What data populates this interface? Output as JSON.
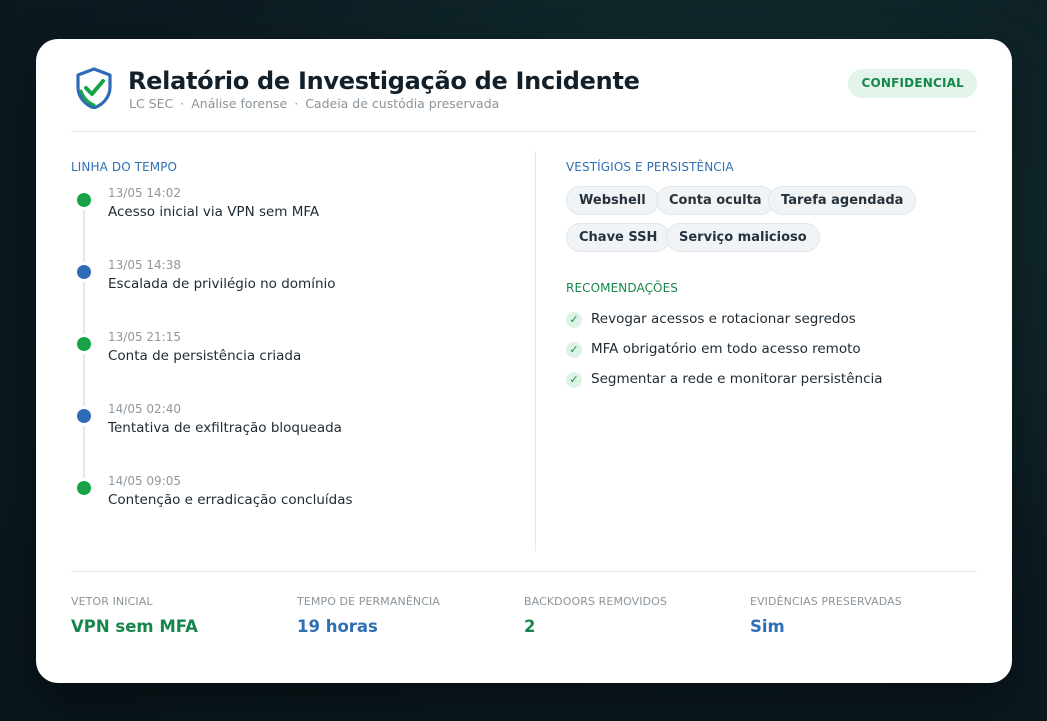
{
  "header": {
    "title": "Relatório de Investigação de Incidente",
    "subtitle": [
      "LC SEC",
      "Análise forense",
      "Cadeia de custódia preservada"
    ],
    "badge": "CONFIDENCIAL"
  },
  "colors": {
    "green": "#16a34a",
    "blue": "#2e6ab8",
    "green_text": "#16874a",
    "blue_text": "#2f6fb3"
  },
  "timeline": {
    "label": "LINHA DO TEMPO",
    "events": [
      {
        "time": "13/05  14:02",
        "text": "Acesso inicial via VPN sem MFA",
        "color": "green"
      },
      {
        "time": "13/05  14:38",
        "text": "Escalada de privilégio no domínio",
        "color": "blue"
      },
      {
        "time": "13/05  21:15",
        "text": "Conta de persistência criada",
        "color": "green"
      },
      {
        "time": "14/05  02:40",
        "text": "Tentativa de exfiltração bloqueada",
        "color": "blue"
      },
      {
        "time": "14/05  09:05",
        "text": "Contenção e erradicação concluídas",
        "color": "green"
      }
    ]
  },
  "traces": {
    "label": "VESTÍGIOS E PERSISTÊNCIA",
    "chips": [
      "Webshell",
      "Conta oculta",
      "Tarefa agendada",
      "Chave SSH",
      "Serviço malicioso"
    ]
  },
  "recommendations": {
    "label": "RECOMENDAÇÕES",
    "items": [
      "Revogar acessos e rotacionar segredos",
      "MFA obrigatório em todo acesso remoto",
      "Segmentar a rede e monitorar persistência"
    ]
  },
  "stats": [
    {
      "label": "VETOR INICIAL",
      "value": "VPN sem MFA",
      "color": "green"
    },
    {
      "label": "TEMPO DE PERMANÊNCIA",
      "value": "19 horas",
      "color": "blue"
    },
    {
      "label": "BACKDOORS REMOVIDOS",
      "value": "2",
      "color": "green"
    },
    {
      "label": "EVIDÊNCIAS PRESERVADAS",
      "value": "Sim",
      "color": "blue"
    }
  ]
}
